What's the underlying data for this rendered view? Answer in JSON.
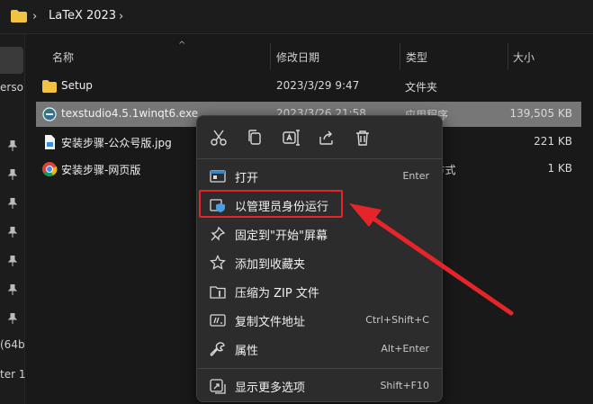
{
  "address": {
    "path": "LaTeX 2023",
    "chevron": "›"
  },
  "nav": {
    "fragments": [
      "erso",
      "(64b",
      "ter 1"
    ]
  },
  "columns": {
    "name": "名称",
    "date": "修改日期",
    "type": "类型",
    "size": "大小",
    "sort_indicator": "^"
  },
  "files": [
    {
      "name": "Setup",
      "date": "2023/3/29 9:47",
      "type": "文件夹",
      "size": "",
      "icon": "folder-icon"
    },
    {
      "name": "texstudio4.5.1winqt6.exe",
      "date": "2023/3/26 21:58",
      "type": "应用程序",
      "size": "139,505 KB",
      "icon": "exe-icon"
    },
    {
      "name": "安装步骤-公众号版.jpg",
      "date": "",
      "type": "件",
      "size": "221 KB",
      "icon": "image-file-icon"
    },
    {
      "name": "安装步骤-网页版",
      "date": "",
      "type": "t 快捷方式",
      "size": "1 KB",
      "icon": "chrome-shortcut-icon"
    }
  ],
  "menu": {
    "toolbar": [
      "cut-icon",
      "copy-icon",
      "rename-icon",
      "share-icon",
      "delete-icon"
    ],
    "items": [
      {
        "label": "打开",
        "shortcut": "Enter",
        "icon": "open-icon"
      },
      {
        "label": "以管理员身份运行",
        "shortcut": "",
        "icon": "shield-icon"
      },
      {
        "label": "固定到\"开始\"屏幕",
        "shortcut": "",
        "icon": "pin-icon"
      },
      {
        "label": "添加到收藏夹",
        "shortcut": "",
        "icon": "star-icon"
      },
      {
        "label": "压缩为 ZIP 文件",
        "shortcut": "",
        "icon": "zip-icon"
      },
      {
        "label": "复制文件地址",
        "shortcut": "Ctrl+Shift+C",
        "icon": "copy-path-icon"
      },
      {
        "label": "属性",
        "shortcut": "Alt+Enter",
        "icon": "wrench-icon"
      },
      {
        "label": "显示更多选项",
        "shortcut": "Shift+F10",
        "icon": "more-options-icon"
      }
    ]
  },
  "colors": {
    "annotation": "#e5252a",
    "folder": "#f2c243",
    "selection": "#777777"
  }
}
